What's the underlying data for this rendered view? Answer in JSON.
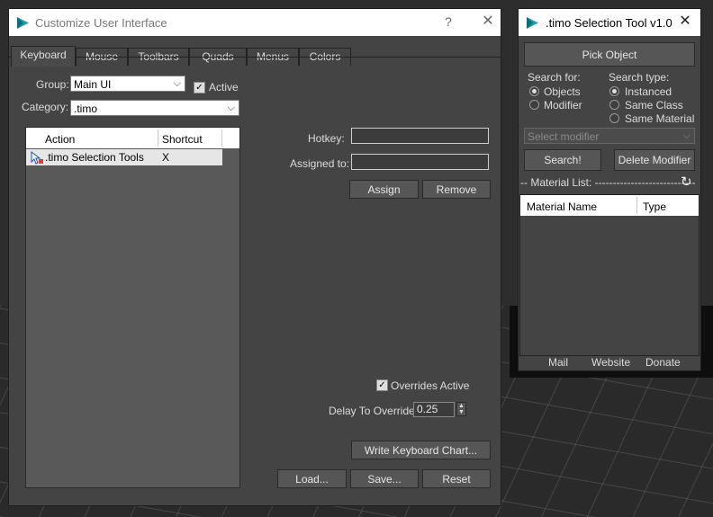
{
  "cui": {
    "title": "Customize User Interface",
    "help": "?",
    "close": "✕",
    "tabs": [
      "Keyboard",
      "Mouse",
      "Toolbars",
      "Quads",
      "Menus",
      "Colors"
    ],
    "group_label": "Group:",
    "group_value": "Main UI",
    "active_label": "Active",
    "category_label": "Category:",
    "category_value": ".timo",
    "columns": [
      "Action",
      "Shortcut"
    ],
    "rows": [
      {
        "action": ".timo Selection Tools",
        "shortcut": "X"
      }
    ],
    "hotkey_label": "Hotkey:",
    "assigned_label": "Assigned to:",
    "assign": "Assign",
    "remove": "Remove",
    "overrides_label": "Overrides Active",
    "delay_label": "Delay To Override:",
    "delay_value": "0.25",
    "write_chart": "Write Keyboard Chart...",
    "load": "Load...",
    "save": "Save...",
    "reset": "Reset"
  },
  "timo": {
    "title": ".timo Selection Tool v1.0",
    "close": "✕",
    "pick_object": "Pick Object",
    "search_for_label": "Search for:",
    "search_for_options": [
      "Objects",
      "Modifier"
    ],
    "search_type_label": "Search type:",
    "search_type_options": [
      "Instanced",
      "Same Class",
      "Same Material"
    ],
    "modifier_placeholder": "Select modifier",
    "search": "Search!",
    "delete_modifier": "Delete Modifier",
    "material_list_label": "-- Material List: ----------------------------",
    "columns": [
      "Material Name",
      "Type"
    ],
    "links": [
      "Mail",
      "Website",
      "Donate"
    ]
  }
}
